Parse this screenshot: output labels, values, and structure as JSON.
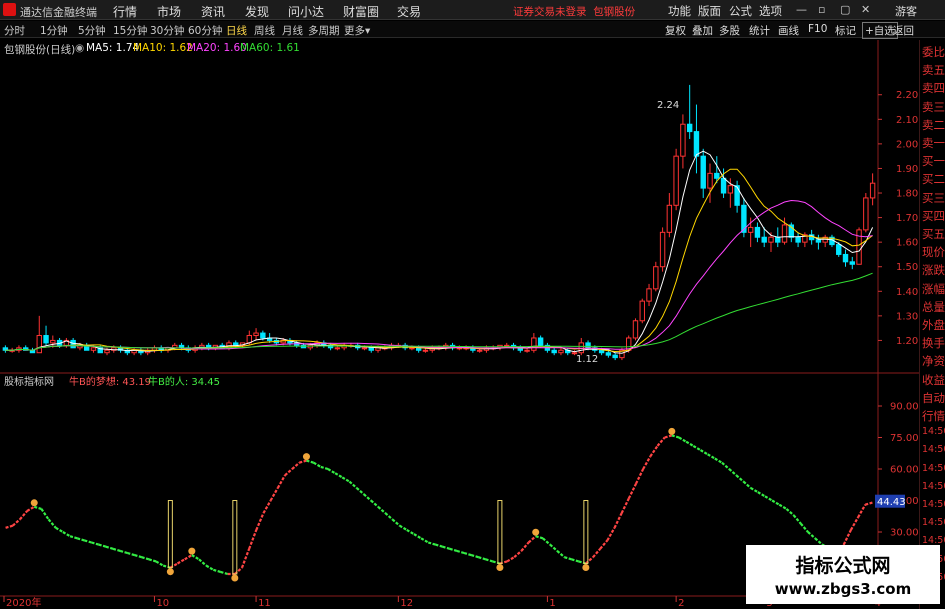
{
  "app": {
    "title": "通达信金融终端",
    "notice": "证券交易未登录",
    "stock_link": "包钢股份",
    "guest": "游客"
  },
  "menus": [
    "行情",
    "市场",
    "资讯",
    "发现",
    "问小达",
    "财富圈",
    "交易"
  ],
  "right_menus": [
    "功能",
    "版面",
    "公式",
    "选项"
  ],
  "periods": [
    "分时",
    "1分钟",
    "5分钟",
    "15分钟",
    "30分钟",
    "60分钟",
    "日线",
    "周线",
    "月线",
    "多周期",
    "更多"
  ],
  "active_period": "日线",
  "tools": [
    "复权",
    "叠加",
    "多股",
    "统计",
    "画线",
    "F10",
    "标记",
    "+自选",
    "返回"
  ],
  "main_header": {
    "title": "包钢股份(日线)",
    "ma5": "MA5: 1.74",
    "ma10": "MA10: 1.62",
    "ma20": "MA20: 1.60",
    "ma60": "MA60: 1.61"
  },
  "sub_header": {
    "title": "股标指标网",
    "a": "牛B的梦想: 43.19",
    "b": "牛B的人: 34.45"
  },
  "side_labels": [
    "委比",
    "卖五",
    "卖四",
    "卖三",
    "卖二",
    "卖一",
    "买一",
    "买二",
    "买三",
    "买四",
    "买五",
    "现价",
    "涨跌",
    "涨幅",
    "总量",
    "外盘",
    "换手",
    "净资",
    "收益",
    "自动",
    "行情",
    "14:50",
    "14:50",
    "14:50",
    "14:50",
    "14:50",
    "14:50",
    "14:50",
    "14:50",
    "14:50"
  ],
  "price_axis": [
    "2.20",
    "2.10",
    "2.00",
    "1.90",
    "1.80",
    "1.70",
    "1.60",
    "1.50",
    "1.40",
    "1.30",
    "1.20"
  ],
  "indicator_axis": [
    "90.00",
    "75.00",
    "60.00",
    "45.00",
    "30.00"
  ],
  "indicator_current": "44.43",
  "date_axis": [
    "2020年",
    "10",
    "11",
    "12",
    "1",
    "2",
    "3",
    "4"
  ],
  "annotations": {
    "high": "2.24",
    "low": "1.12"
  },
  "watermark": {
    "title": "指标公式网",
    "url": "www.zbgs3.com"
  },
  "colors": {
    "up": "#ff3333",
    "down": "#00e5ff",
    "ma5": "#ffffff",
    "ma10": "#ffd700",
    "ma20": "#ff44ff",
    "ma60": "#33dd33",
    "line_up": "#ff4444",
    "line_down": "#33ee44"
  },
  "chart_data": {
    "type": "candlestick",
    "price_range": [
      1.12,
      2.24
    ],
    "ohlc": [
      [
        1.17,
        1.18,
        1.15,
        1.16
      ],
      [
        1.16,
        1.17,
        1.15,
        1.16
      ],
      [
        1.16,
        1.18,
        1.15,
        1.17
      ],
      [
        1.17,
        1.18,
        1.16,
        1.16
      ],
      [
        1.16,
        1.17,
        1.15,
        1.15
      ],
      [
        1.15,
        1.3,
        1.15,
        1.22
      ],
      [
        1.22,
        1.26,
        1.18,
        1.19
      ],
      [
        1.19,
        1.22,
        1.17,
        1.2
      ],
      [
        1.2,
        1.21,
        1.17,
        1.18
      ],
      [
        1.18,
        1.21,
        1.17,
        1.2
      ],
      [
        1.2,
        1.21,
        1.17,
        1.17
      ],
      [
        1.17,
        1.19,
        1.16,
        1.18
      ],
      [
        1.18,
        1.19,
        1.16,
        1.16
      ],
      [
        1.16,
        1.18,
        1.15,
        1.17
      ],
      [
        1.17,
        1.18,
        1.15,
        1.15
      ],
      [
        1.15,
        1.17,
        1.14,
        1.16
      ],
      [
        1.16,
        1.18,
        1.15,
        1.17
      ],
      [
        1.17,
        1.18,
        1.15,
        1.16
      ],
      [
        1.16,
        1.17,
        1.14,
        1.15
      ],
      [
        1.15,
        1.17,
        1.14,
        1.16
      ],
      [
        1.16,
        1.17,
        1.14,
        1.15
      ],
      [
        1.15,
        1.17,
        1.14,
        1.16
      ],
      [
        1.16,
        1.18,
        1.15,
        1.17
      ],
      [
        1.17,
        1.18,
        1.15,
        1.16
      ],
      [
        1.16,
        1.17,
        1.15,
        1.17
      ],
      [
        1.17,
        1.19,
        1.16,
        1.18
      ],
      [
        1.18,
        1.19,
        1.16,
        1.17
      ],
      [
        1.17,
        1.18,
        1.15,
        1.16
      ],
      [
        1.16,
        1.18,
        1.15,
        1.17
      ],
      [
        1.17,
        1.19,
        1.16,
        1.18
      ],
      [
        1.18,
        1.19,
        1.16,
        1.17
      ],
      [
        1.17,
        1.18,
        1.16,
        1.18
      ],
      [
        1.18,
        1.19,
        1.17,
        1.17
      ],
      [
        1.17,
        1.2,
        1.16,
        1.19
      ],
      [
        1.19,
        1.2,
        1.17,
        1.18
      ],
      [
        1.18,
        1.19,
        1.17,
        1.19
      ],
      [
        1.19,
        1.24,
        1.18,
        1.22
      ],
      [
        1.22,
        1.25,
        1.2,
        1.23
      ],
      [
        1.23,
        1.24,
        1.2,
        1.21
      ],
      [
        1.21,
        1.23,
        1.19,
        1.2
      ],
      [
        1.2,
        1.21,
        1.18,
        1.19
      ],
      [
        1.19,
        1.21,
        1.18,
        1.2
      ],
      [
        1.2,
        1.21,
        1.18,
        1.19
      ],
      [
        1.19,
        1.2,
        1.17,
        1.18
      ],
      [
        1.18,
        1.19,
        1.17,
        1.17
      ],
      [
        1.17,
        1.19,
        1.16,
        1.18
      ],
      [
        1.18,
        1.2,
        1.17,
        1.19
      ],
      [
        1.19,
        1.2,
        1.17,
        1.18
      ],
      [
        1.18,
        1.19,
        1.16,
        1.17
      ],
      [
        1.17,
        1.18,
        1.16,
        1.17
      ],
      [
        1.17,
        1.19,
        1.16,
        1.18
      ],
      [
        1.18,
        1.19,
        1.17,
        1.18
      ],
      [
        1.18,
        1.19,
        1.16,
        1.17
      ],
      [
        1.17,
        1.18,
        1.16,
        1.17
      ],
      [
        1.17,
        1.18,
        1.15,
        1.16
      ],
      [
        1.16,
        1.18,
        1.15,
        1.17
      ],
      [
        1.17,
        1.18,
        1.16,
        1.17
      ],
      [
        1.17,
        1.19,
        1.16,
        1.18
      ],
      [
        1.18,
        1.19,
        1.17,
        1.18
      ],
      [
        1.18,
        1.19,
        1.16,
        1.17
      ],
      [
        1.17,
        1.18,
        1.16,
        1.17
      ],
      [
        1.17,
        1.18,
        1.15,
        1.16
      ],
      [
        1.16,
        1.17,
        1.15,
        1.16
      ],
      [
        1.16,
        1.18,
        1.15,
        1.17
      ],
      [
        1.17,
        1.18,
        1.16,
        1.17
      ],
      [
        1.17,
        1.19,
        1.16,
        1.18
      ],
      [
        1.18,
        1.19,
        1.16,
        1.17
      ],
      [
        1.17,
        1.18,
        1.16,
        1.17
      ],
      [
        1.17,
        1.18,
        1.16,
        1.17
      ],
      [
        1.17,
        1.18,
        1.15,
        1.16
      ],
      [
        1.16,
        1.17,
        1.15,
        1.16
      ],
      [
        1.16,
        1.18,
        1.15,
        1.17
      ],
      [
        1.17,
        1.18,
        1.16,
        1.17
      ],
      [
        1.17,
        1.18,
        1.16,
        1.18
      ],
      [
        1.18,
        1.19,
        1.17,
        1.18
      ],
      [
        1.18,
        1.19,
        1.16,
        1.17
      ],
      [
        1.17,
        1.18,
        1.15,
        1.16
      ],
      [
        1.16,
        1.17,
        1.15,
        1.16
      ],
      [
        1.16,
        1.23,
        1.15,
        1.21
      ],
      [
        1.21,
        1.22,
        1.17,
        1.18
      ],
      [
        1.18,
        1.19,
        1.15,
        1.16
      ],
      [
        1.16,
        1.17,
        1.14,
        1.15
      ],
      [
        1.15,
        1.17,
        1.14,
        1.16
      ],
      [
        1.16,
        1.17,
        1.14,
        1.15
      ],
      [
        1.15,
        1.16,
        1.14,
        1.15
      ],
      [
        1.15,
        1.21,
        1.14,
        1.19
      ],
      [
        1.19,
        1.2,
        1.16,
        1.17
      ],
      [
        1.17,
        1.18,
        1.15,
        1.16
      ],
      [
        1.16,
        1.17,
        1.14,
        1.15
      ],
      [
        1.15,
        1.16,
        1.13,
        1.14
      ],
      [
        1.14,
        1.15,
        1.12,
        1.13
      ],
      [
        1.13,
        1.17,
        1.12,
        1.16
      ],
      [
        1.16,
        1.22,
        1.15,
        1.21
      ],
      [
        1.21,
        1.29,
        1.2,
        1.28
      ],
      [
        1.28,
        1.37,
        1.27,
        1.36
      ],
      [
        1.36,
        1.43,
        1.34,
        1.41
      ],
      [
        1.41,
        1.52,
        1.4,
        1.5
      ],
      [
        1.5,
        1.66,
        1.48,
        1.64
      ],
      [
        1.64,
        1.8,
        1.62,
        1.75
      ],
      [
        1.75,
        1.98,
        1.73,
        1.95
      ],
      [
        1.95,
        2.12,
        1.9,
        2.08
      ],
      [
        2.08,
        2.24,
        2.02,
        2.05
      ],
      [
        2.05,
        2.16,
        1.88,
        1.95
      ],
      [
        1.95,
        1.98,
        1.78,
        1.82
      ],
      [
        1.82,
        1.92,
        1.76,
        1.88
      ],
      [
        1.88,
        1.95,
        1.84,
        1.86
      ],
      [
        1.86,
        1.9,
        1.78,
        1.8
      ],
      [
        1.8,
        1.86,
        1.74,
        1.83
      ],
      [
        1.83,
        1.85,
        1.72,
        1.75
      ],
      [
        1.75,
        1.78,
        1.62,
        1.64
      ],
      [
        1.64,
        1.7,
        1.58,
        1.66
      ],
      [
        1.66,
        1.68,
        1.6,
        1.62
      ],
      [
        1.62,
        1.66,
        1.58,
        1.6
      ],
      [
        1.6,
        1.64,
        1.56,
        1.62
      ],
      [
        1.62,
        1.66,
        1.58,
        1.6
      ],
      [
        1.6,
        1.7,
        1.59,
        1.67
      ],
      [
        1.67,
        1.68,
        1.6,
        1.62
      ],
      [
        1.62,
        1.64,
        1.58,
        1.6
      ],
      [
        1.6,
        1.64,
        1.58,
        1.63
      ],
      [
        1.63,
        1.65,
        1.59,
        1.61
      ],
      [
        1.61,
        1.63,
        1.57,
        1.6
      ],
      [
        1.6,
        1.63,
        1.58,
        1.62
      ],
      [
        1.62,
        1.63,
        1.58,
        1.59
      ],
      [
        1.59,
        1.6,
        1.54,
        1.55
      ],
      [
        1.55,
        1.57,
        1.5,
        1.52
      ],
      [
        1.52,
        1.54,
        1.49,
        1.51
      ],
      [
        1.51,
        1.66,
        1.51,
        1.65
      ],
      [
        1.65,
        1.8,
        1.64,
        1.78
      ],
      [
        1.78,
        1.88,
        1.75,
        1.84
      ]
    ],
    "indicator": [
      32,
      33,
      36,
      40,
      42,
      41,
      36,
      32,
      30,
      28,
      27,
      26,
      25,
      24,
      23,
      22,
      21,
      20,
      19,
      18,
      17,
      16,
      14,
      13,
      15,
      17,
      19,
      17,
      14,
      12,
      11,
      10,
      10,
      13,
      22,
      31,
      39,
      45,
      51,
      57,
      60,
      63,
      64,
      63,
      61,
      60,
      58,
      56,
      54,
      51,
      48,
      45,
      42,
      39,
      36,
      33,
      31,
      29,
      27,
      25,
      24,
      23,
      22,
      21,
      20,
      19,
      18,
      17,
      16,
      15,
      16,
      18,
      21,
      25,
      28,
      27,
      24,
      21,
      18,
      17,
      16,
      15,
      18,
      22,
      26,
      32,
      39,
      46,
      53,
      60,
      66,
      71,
      75,
      76,
      75,
      73,
      71,
      69,
      67,
      65,
      63,
      60,
      57,
      54,
      51,
      49,
      47,
      45,
      43,
      41,
      38,
      34,
      30,
      27,
      24,
      22,
      21,
      24,
      31,
      37,
      43,
      44
    ],
    "indicator_range": [
      0,
      100
    ]
  }
}
